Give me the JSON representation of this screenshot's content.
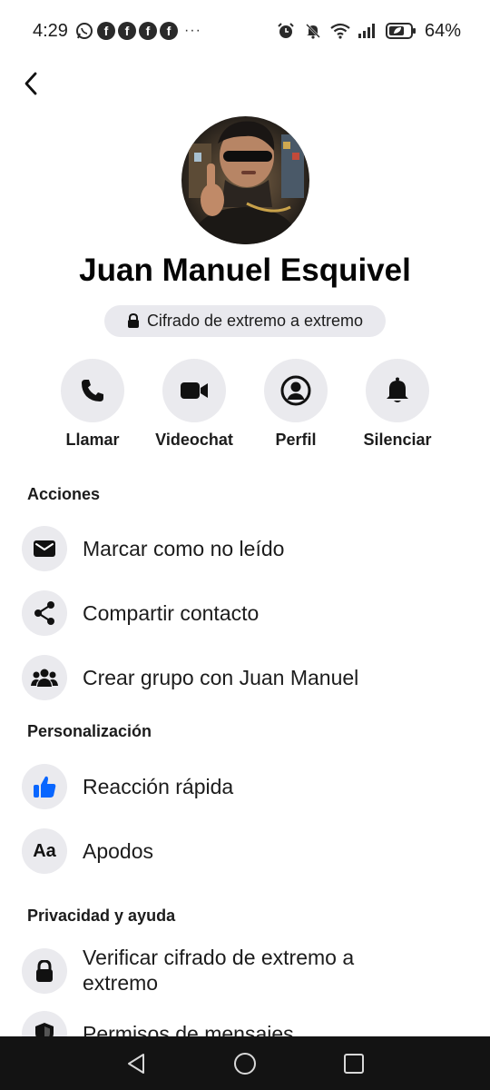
{
  "status_bar": {
    "time": "4:29",
    "more": "···",
    "battery": "64%",
    "notif_letter": "f"
  },
  "contact": {
    "name": "Juan Manuel Esquivel",
    "encryption_label": "Cifrado de extremo a extremo"
  },
  "quick_actions": [
    {
      "label": "Llamar",
      "icon": "phone-icon"
    },
    {
      "label": "Videochat",
      "icon": "video-icon"
    },
    {
      "label": "Perfil",
      "icon": "profile-icon"
    },
    {
      "label": "Silenciar",
      "icon": "bell-icon"
    }
  ],
  "sections": {
    "actions": {
      "title": "Acciones",
      "items": [
        {
          "label": "Marcar como no leído",
          "icon": "envelope-icon"
        },
        {
          "label": "Compartir contacto",
          "icon": "share-icon"
        },
        {
          "label": "Crear grupo con Juan Manuel",
          "icon": "group-icon"
        }
      ]
    },
    "personalization": {
      "title": "Personalización",
      "items": [
        {
          "label": "Reacción rápida",
          "icon": "thumbs-up-icon"
        },
        {
          "label": "Apodos",
          "icon": "text-aa-icon",
          "glyph": "Aa"
        }
      ]
    },
    "privacy": {
      "title": "Privacidad y ayuda",
      "items": [
        {
          "label": "Verificar cifrado de extremo a extremo",
          "icon": "lock-icon"
        },
        {
          "label": "Permisos de mensajes",
          "icon": "shield-icon"
        }
      ]
    }
  },
  "colors": {
    "accent": "#0866ff",
    "icon_bg": "#eaeaee",
    "nav_bg": "#131313"
  }
}
